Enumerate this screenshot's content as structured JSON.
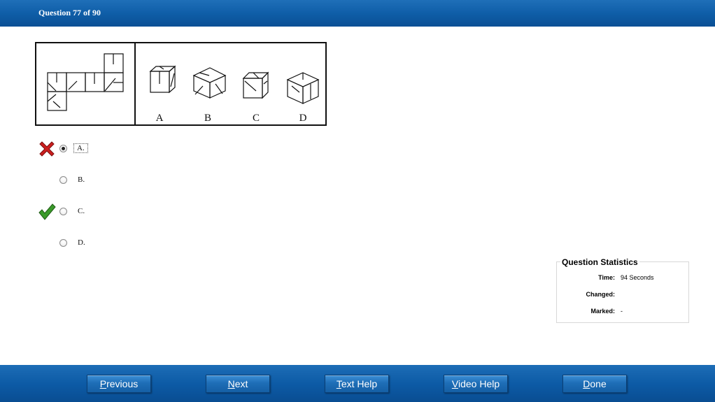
{
  "header": {
    "title": "Question 77 of 90"
  },
  "figure": {
    "option_letters": [
      "A",
      "B",
      "C",
      "D"
    ]
  },
  "options": [
    {
      "label": "A.",
      "selected": true,
      "mark": "wrong-x-icon",
      "focused": true
    },
    {
      "label": "B.",
      "selected": false,
      "mark": "",
      "focused": false
    },
    {
      "label": "C.",
      "selected": false,
      "mark": "correct-check-icon",
      "focused": false
    },
    {
      "label": "D.",
      "selected": false,
      "mark": "",
      "focused": false
    }
  ],
  "stats": {
    "title": "Question Statistics",
    "time_label": "Time:",
    "time_value": "94 Seconds",
    "changed_label": "Changed:",
    "changed_value": "",
    "marked_label": "Marked:",
    "marked_value": "-"
  },
  "footer": {
    "buttons": [
      {
        "label_first": "P",
        "label_rest": "revious"
      },
      {
        "label_first": "N",
        "label_rest": "ext"
      },
      {
        "label_first": "T",
        "label_rest": "ext Help"
      },
      {
        "label_first": "V",
        "label_rest": "ideo Help"
      },
      {
        "label_first": "D",
        "label_rest": "one"
      }
    ]
  },
  "colors": {
    "header_blue": "#0f5ea8",
    "wrong": "#cc1f1f",
    "correct": "#3a9a2a"
  }
}
